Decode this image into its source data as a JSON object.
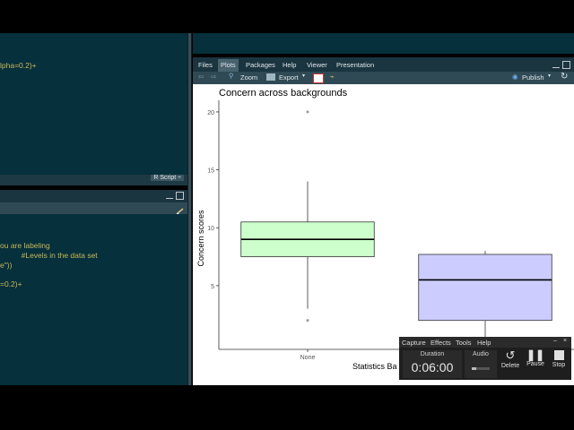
{
  "editor": {
    "code_lines": [
      "lpha=0.2)+"
    ],
    "status": "R Script ÷"
  },
  "console": {
    "lines": [
      "ou are labeling",
      "          #Levels in the data set",
      "e\"))",
      "",
      "=0.2)+"
    ]
  },
  "tabs": [
    "Files",
    "Plots",
    "Packages",
    "Help",
    "Viewer",
    "Presentation"
  ],
  "active_tab": "Plots",
  "toolbar": {
    "zoom": "Zoom",
    "export": "Export",
    "publish": "Publish"
  },
  "chart_data": {
    "type": "boxplot",
    "title": "Concern across backgrounds",
    "xlabel": "Statistics Ba",
    "ylabel": "Concern scores",
    "yticks": [
      5,
      10,
      15,
      20
    ],
    "ylim": [
      -0.5,
      21
    ],
    "categories": [
      "None",
      ""
    ],
    "boxes": [
      {
        "category": "None",
        "q1": 7.5,
        "median": 9,
        "q3": 10.5,
        "whisker_low": 3,
        "whisker_high": 14,
        "outliers": [
          2,
          20
        ],
        "fill": "#ccffcc"
      },
      {
        "category": "",
        "q1": 2,
        "median": 5.5,
        "q3": 7.7,
        "whisker_low": 0,
        "whisker_high": 8,
        "outliers": [],
        "fill": "#ccccff"
      }
    ]
  },
  "capture": {
    "menu": [
      "Capture",
      "Effects",
      "Tools",
      "Help"
    ],
    "duration_label": "Duration",
    "duration_value": "0:06:00",
    "audio_label": "Audio",
    "buttons": [
      "Delete",
      "Pause",
      "Stop"
    ]
  }
}
